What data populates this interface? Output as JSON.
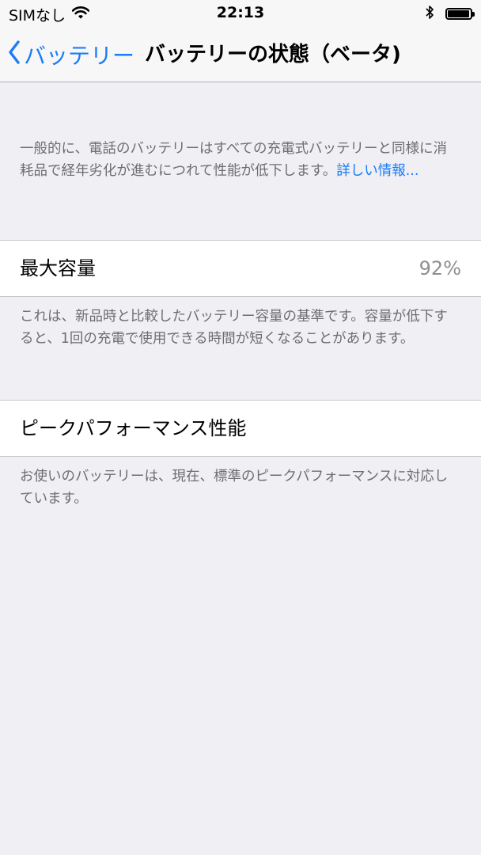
{
  "status_bar": {
    "carrier": "SIMなし",
    "time": "22:13",
    "wifi_icon": "wifi-icon",
    "bluetooth_icon": "bluetooth-icon",
    "battery_icon": "battery-icon",
    "battery_level": 0.95
  },
  "nav": {
    "back_label": "バッテリー",
    "back_icon": "chevron-left-icon",
    "title": "バッテリーの状態（ベータ)"
  },
  "intro": {
    "text": "一般的に、電話のバッテリーはすべての充電式バッテリーと同様に消耗品で経年劣化が進むにつれて性能が低下します。",
    "link": "詳しい情報..."
  },
  "max_capacity": {
    "label": "最大容量",
    "value": "92%",
    "footer": "これは、新品時と比較したバッテリー容量の基準です。容量が低下すると、1回の充電で使用できる時間が短くなることがあります。"
  },
  "peak_performance": {
    "label": "ピークパフォーマンス性能",
    "footer": "お使いのバッテリーは、現在、標準のピークパフォーマンスに対応しています。"
  },
  "colors": {
    "accent": "#1a7cf8",
    "background": "#efeff4",
    "secondary_text": "#6d6d72",
    "value_text": "#8e8e93"
  }
}
